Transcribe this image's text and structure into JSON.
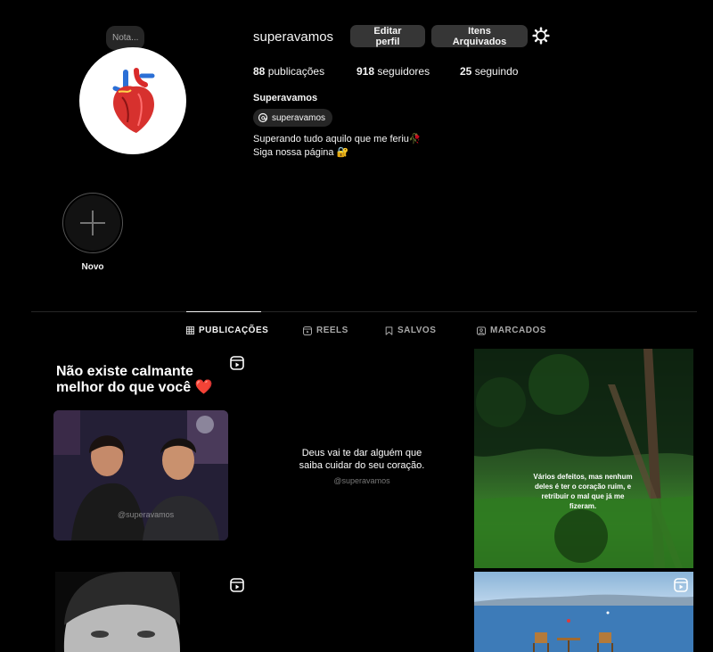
{
  "profile": {
    "note_placeholder": "Nota...",
    "username": "superavamos",
    "edit_button": "Editar perfil",
    "archive_button": "Itens Arquivados",
    "stats": {
      "posts_count": "88",
      "posts_label": "publicações",
      "followers_count": "918",
      "followers_label": "seguidores",
      "following_count": "25",
      "following_label": "seguindo"
    },
    "full_name": "Superavamos",
    "threads_handle": "superavamos",
    "bio_line1": "Superando tudo aquilo que me feriu🥀",
    "bio_line2": "Siga nossa página 🔐"
  },
  "highlights": [
    {
      "label": "Novo",
      "icon": "plus-icon"
    }
  ],
  "tabs": [
    {
      "label": "PUBLICAÇÕES",
      "icon": "grid-icon",
      "active": true
    },
    {
      "label": "REELS",
      "icon": "reels-icon",
      "active": false
    },
    {
      "label": "SALVOS",
      "icon": "bookmark-icon",
      "active": false
    },
    {
      "label": "MARCADOS",
      "icon": "tag-icon",
      "active": false
    }
  ],
  "posts": [
    {
      "type": "reel",
      "title_line1": "Não existe calmante",
      "title_line2": "melhor do que você ❤️",
      "watermark": "@superavamos"
    },
    {
      "type": "image",
      "text_line1": "Deus vai te dar alguém que",
      "text_line2": "saiba cuidar do seu coração.",
      "handle": "@superavamos"
    },
    {
      "type": "image",
      "text": "Vários defeitos, mas nenhum deles é ter o coração ruim, e retribuir o mal que já me fizeram."
    },
    {
      "type": "reel"
    },
    {
      "type": "reel"
    }
  ],
  "colors": {
    "background": "#000000",
    "button_bg": "#363636",
    "pill_bg": "#262626",
    "text": "#f5f5f5",
    "muted": "#a8a8a8"
  }
}
